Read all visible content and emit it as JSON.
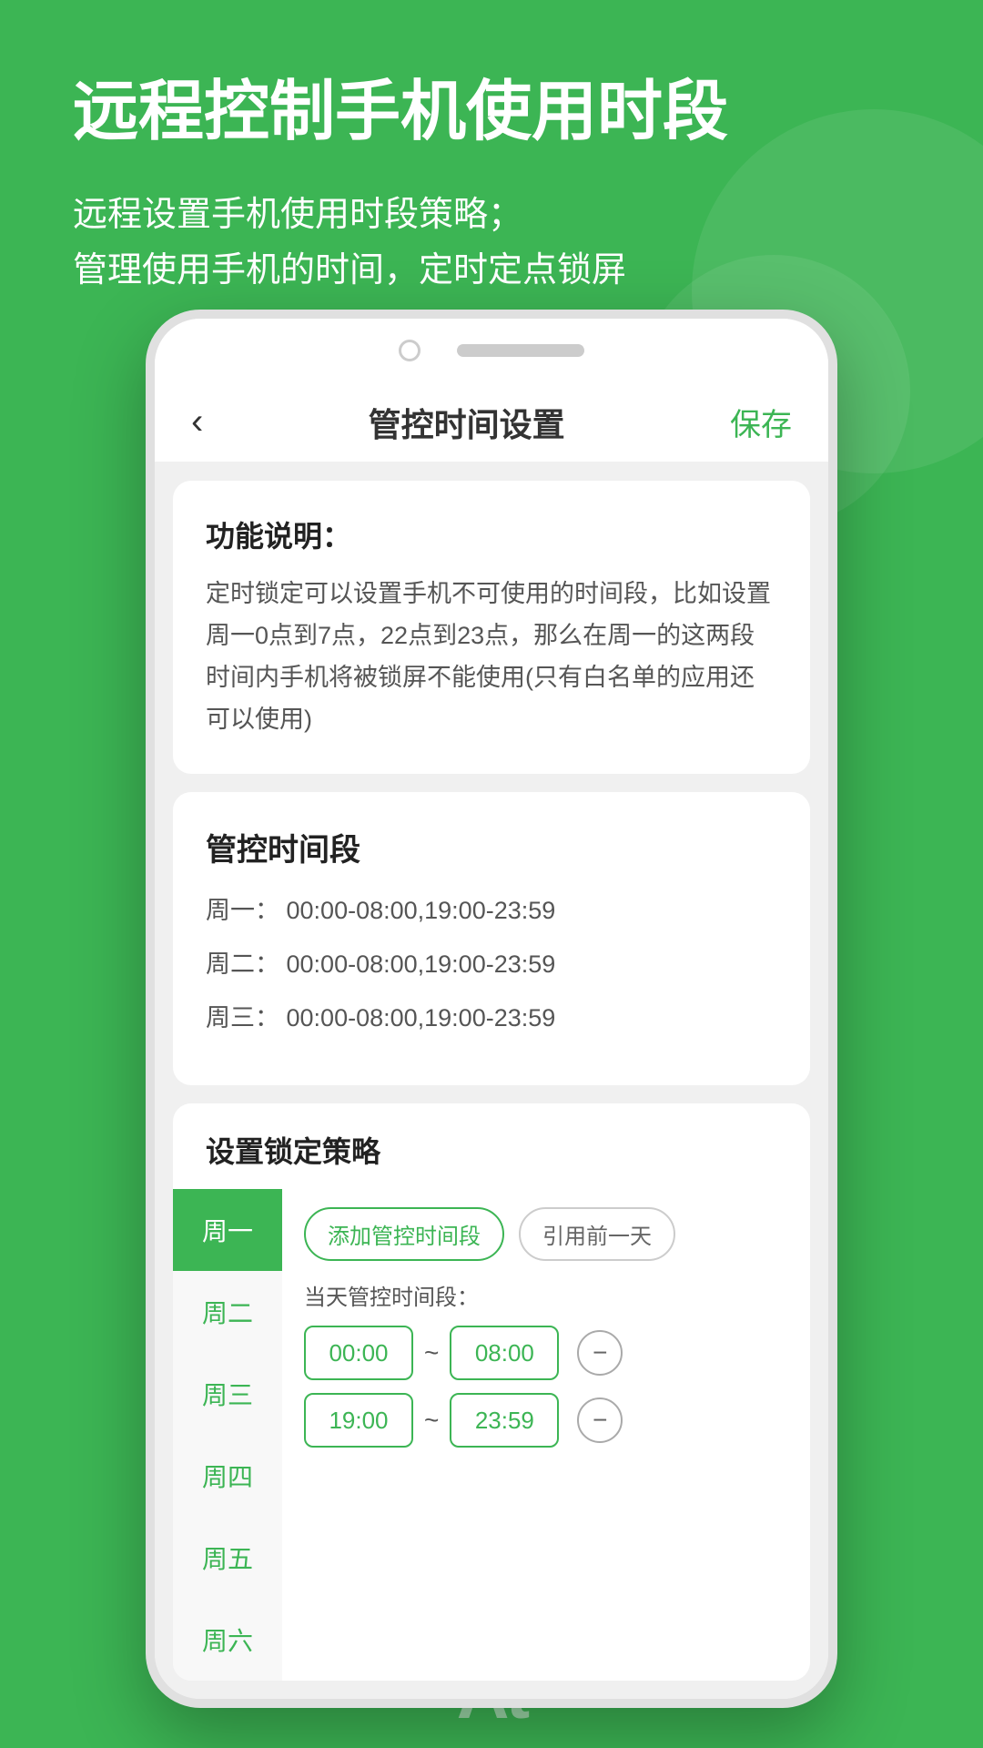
{
  "background_color": "#3cb554",
  "header": {
    "main_title": "远程控制手机使用时段",
    "sub_line1": "远程设置手机使用时段策略；",
    "sub_line2": "管理使用手机的时间，定时定点锁屏"
  },
  "app": {
    "nav": {
      "back_icon": "‹",
      "title": "管控时间设置",
      "save_label": "保存"
    },
    "feature_desc": {
      "title": "功能说明：",
      "content": "定时锁定可以设置手机不可使用的时间段，比如设置周一0点到7点，22点到23点，那么在周一的这两段时间内手机将被锁屏不能使用(只有白名单的应用还可以使用)"
    },
    "managed_periods": {
      "title": "管控时间段",
      "rows": [
        {
          "label": "周一：",
          "value": "00:00-08:00,19:00-23:59"
        },
        {
          "label": "周二：",
          "value": "00:00-08:00,19:00-23:59"
        },
        {
          "label": "周三：",
          "value": "00:00-08:00,19:00-23:59"
        }
      ]
    },
    "strategy": {
      "title": "设置锁定策略",
      "days": [
        {
          "label": "周一",
          "active": true
        },
        {
          "label": "周二",
          "active": false
        },
        {
          "label": "周三",
          "active": false
        },
        {
          "label": "周四",
          "active": false
        },
        {
          "label": "周五",
          "active": false
        },
        {
          "label": "周六",
          "active": false
        }
      ],
      "btn_add": "添加管控时间段",
      "btn_copy": "引用前一天",
      "current_period_label": "当天管控时间段：",
      "time_slots": [
        {
          "start": "00:00",
          "end": "08:00"
        },
        {
          "start": "19:00",
          "end": "23:59"
        }
      ]
    }
  },
  "bottom": {
    "at_text": "At"
  }
}
